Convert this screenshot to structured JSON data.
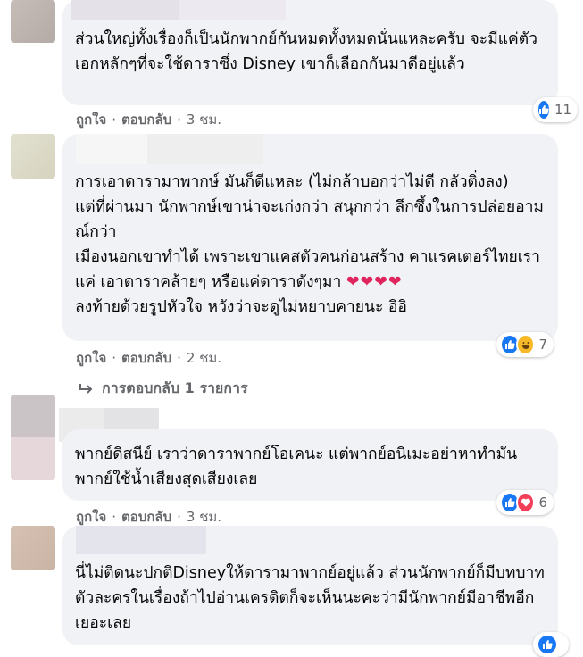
{
  "comments": [
    {
      "text": "ส่วนใหญ่ทั้งเรื่องก็เป็นนักพากย์กันหมดทั้งหมดนั่นแหละครับ จะมีแค่ตัวเอกหลักๆที่จะใช้ดาราซึ่ง Disney เขาก็เลือกกันมาดีอยู่แล้ว",
      "like_label": "ถูกใจ",
      "reply_label": "ตอบกลับ",
      "time": "3 ชม.",
      "reaction_count": "11",
      "reactions": [
        "like"
      ]
    },
    {
      "lines": [
        "การเอาดารามาพากษ์ มันก็ดีแหละ (ไม่กล้าบอกว่าไม่ดี กลัวติ่งลง)",
        "แต่ที่ผ่านมา นักพากษ์เขาน่าจะเก่งกว่า สนุกกว่า ลึกซึ้งในการปล่อยอามณ์กว่า",
        "เมืองนอกเขาทำได้ เพราะเขาแคสตัวคนก่อนสร้าง คาแรคเตอร์ไทยเราแค่ เอาดาราคล้ายๆ หรือแค่ดาราดังๆมา",
        "ลงท้ายด้วยรูปหัวใจ หวังว่าจะดูไม่หยาบคายนะ อิอิ"
      ],
      "hearts": "❤❤❤❤",
      "like_label": "ถูกใจ",
      "reply_label": "ตอบกลับ",
      "time": "2 ชม.",
      "reaction_count": "7",
      "reactions": [
        "like",
        "haha"
      ],
      "replies_label": "การตอบกลับ 1 รายการ"
    },
    {
      "text": "พากย์ดิสนีย์ เราว่าดาราพากย์โอเคนะ แต่พากย์อนิเมะอย่าหาทำมันพากย์ใช้น้ำเสียงสุดเสียงเลย",
      "like_label": "ถูกใจ",
      "reply_label": "ตอบกลับ",
      "time": "3 ชม.",
      "reaction_count": "6",
      "reactions": [
        "like",
        "love"
      ]
    },
    {
      "text": "นี่ไม่ติดนะปกติDisneyให้ดารามาพากย์อยู่แล้ว ส่วนนักพากย์ก็มีบทบาทตัวละครในเรื่องถ้าไปอ่านเครดิตก็จะเห็นนะคะว่ามีนักพากย์มีอาชีพอีกเยอะเลย",
      "reactions": [
        "like"
      ]
    }
  ],
  "colors": {
    "bubble": "#f0f2f5",
    "like_blue": "#1877f2",
    "love_red": "#f33e58",
    "haha_yellow": "#f7b928",
    "meta_gray": "#65676b"
  }
}
